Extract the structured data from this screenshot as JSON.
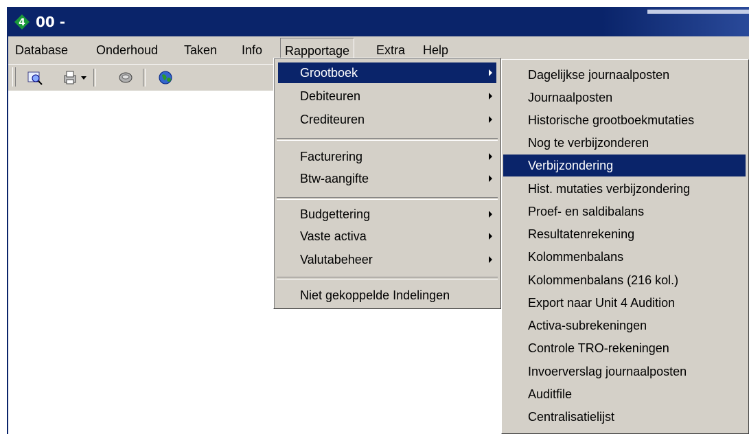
{
  "window": {
    "title": "00 -"
  },
  "menubar": {
    "items": [
      {
        "label": "Database"
      },
      {
        "label": "Onderhoud"
      },
      {
        "label": "Taken"
      },
      {
        "label": "Info"
      },
      {
        "label": "Rapportage"
      },
      {
        "label": "Extra"
      },
      {
        "label": "Help"
      }
    ],
    "active": "Rapportage"
  },
  "toolbar": {
    "icons": [
      "search-icon",
      "print-icon",
      "dropdown-arrow-icon",
      "settings-icon",
      "globe-icon"
    ]
  },
  "rapportage_menu": {
    "groups": [
      [
        {
          "label": "Grootboek",
          "submenu": true,
          "highlighted": true
        },
        {
          "label": "Debiteuren",
          "submenu": true
        },
        {
          "label": "Crediteuren",
          "submenu": true
        }
      ],
      [
        {
          "label": "Facturering",
          "submenu": true
        },
        {
          "label": "Btw-aangifte",
          "submenu": true
        }
      ],
      [
        {
          "label": "Budgettering",
          "submenu": true
        },
        {
          "label": "Vaste activa",
          "submenu": true
        },
        {
          "label": "Valutabeheer",
          "submenu": true
        }
      ],
      [
        {
          "label": "Niet gekoppelde Indelingen",
          "submenu": false
        }
      ]
    ]
  },
  "grootboek_submenu": {
    "items": [
      {
        "label": "Dagelijkse journaalposten"
      },
      {
        "label": "Journaalposten"
      },
      {
        "label": "Historische grootboekmutaties"
      },
      {
        "label": "Nog te verbijzonderen"
      },
      {
        "label": "Verbijzondering",
        "highlighted": true
      },
      {
        "label": "Hist. mutaties verbijzondering"
      },
      {
        "label": "Proef- en saldibalans"
      },
      {
        "label": "Resultatenrekening"
      },
      {
        "label": "Kolommenbalans"
      },
      {
        "label": "Kolommenbalans (216 kol.)"
      },
      {
        "label": "Export naar Unit 4 Audition"
      },
      {
        "label": "Activa-subrekeningen"
      },
      {
        "label": "Controle TRO-rekeningen"
      },
      {
        "label": "Invoerverslag journaalposten"
      },
      {
        "label": "Auditfile"
      },
      {
        "label": "Centralisatielijst"
      }
    ]
  },
  "colors": {
    "highlight": "#0a246a",
    "menu_bg": "#d4d0c8",
    "title_bg": "#0a246a"
  }
}
